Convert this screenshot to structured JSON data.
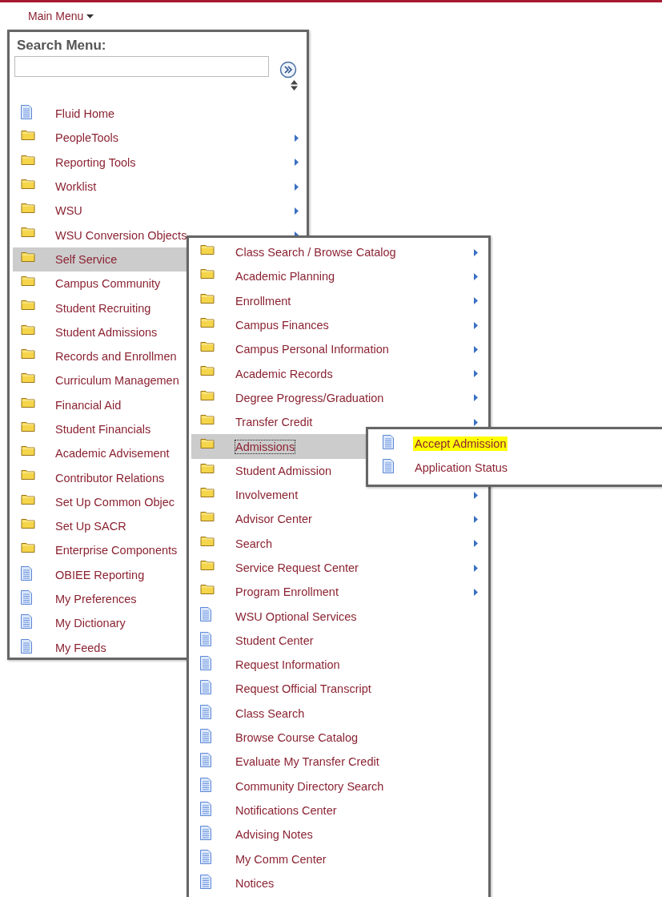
{
  "main_menu": {
    "label": "Main Menu"
  },
  "search_menu": {
    "title": "Search Menu:"
  },
  "menu": [
    {
      "label": "Fluid Home",
      "kind": "page",
      "arrow": false,
      "selected": false
    },
    {
      "label": "PeopleTools",
      "kind": "folder",
      "arrow": true,
      "selected": false
    },
    {
      "label": "Reporting Tools",
      "kind": "folder",
      "arrow": true,
      "selected": false
    },
    {
      "label": "Worklist",
      "kind": "folder",
      "arrow": true,
      "selected": false
    },
    {
      "label": "WSU",
      "kind": "folder",
      "arrow": true,
      "selected": false
    },
    {
      "label": "WSU Conversion Objects",
      "kind": "folder",
      "arrow": true,
      "selected": false
    },
    {
      "label": "Self Service",
      "kind": "folder",
      "arrow": false,
      "selected": true
    },
    {
      "label": "Campus Community",
      "kind": "folder",
      "arrow": false,
      "selected": false
    },
    {
      "label": "Student Recruiting",
      "kind": "folder",
      "arrow": false,
      "selected": false
    },
    {
      "label": "Student Admissions",
      "kind": "folder",
      "arrow": false,
      "selected": false
    },
    {
      "label": "Records and Enrollmen",
      "kind": "folder",
      "arrow": false,
      "selected": false
    },
    {
      "label": "Curriculum Managemen",
      "kind": "folder",
      "arrow": false,
      "selected": false
    },
    {
      "label": "Financial Aid",
      "kind": "folder",
      "arrow": false,
      "selected": false
    },
    {
      "label": "Student Financials",
      "kind": "folder",
      "arrow": false,
      "selected": false
    },
    {
      "label": "Academic Advisement",
      "kind": "folder",
      "arrow": false,
      "selected": false
    },
    {
      "label": "Contributor Relations",
      "kind": "folder",
      "arrow": false,
      "selected": false
    },
    {
      "label": "Set Up Common Objec",
      "kind": "folder",
      "arrow": false,
      "selected": false
    },
    {
      "label": "Set Up SACR",
      "kind": "folder",
      "arrow": false,
      "selected": false
    },
    {
      "label": "Enterprise Components",
      "kind": "folder",
      "arrow": false,
      "selected": false
    },
    {
      "label": "OBIEE Reporting",
      "kind": "page",
      "arrow": false,
      "selected": false
    },
    {
      "label": "My Preferences",
      "kind": "page",
      "arrow": false,
      "selected": false
    },
    {
      "label": "My Dictionary",
      "kind": "page",
      "arrow": false,
      "selected": false
    },
    {
      "label": "My Feeds",
      "kind": "page",
      "arrow": false,
      "selected": false
    }
  ],
  "self_service_menu": [
    {
      "label": "Class Search / Browse Catalog",
      "kind": "folder",
      "arrow": true,
      "selected": false
    },
    {
      "label": "Academic Planning",
      "kind": "folder",
      "arrow": true,
      "selected": false
    },
    {
      "label": "Enrollment",
      "kind": "folder",
      "arrow": true,
      "selected": false
    },
    {
      "label": "Campus Finances",
      "kind": "folder",
      "arrow": true,
      "selected": false
    },
    {
      "label": "Campus Personal Information",
      "kind": "folder",
      "arrow": true,
      "selected": false
    },
    {
      "label": "Academic Records",
      "kind": "folder",
      "arrow": true,
      "selected": false
    },
    {
      "label": "Degree Progress/Graduation",
      "kind": "folder",
      "arrow": true,
      "selected": false
    },
    {
      "label": "Transfer Credit",
      "kind": "folder",
      "arrow": true,
      "selected": false
    },
    {
      "label": "Admissions",
      "kind": "folder",
      "arrow": false,
      "selected": true
    },
    {
      "label": "Student Admission",
      "kind": "folder",
      "arrow": false,
      "selected": false
    },
    {
      "label": "Involvement",
      "kind": "folder",
      "arrow": true,
      "selected": false
    },
    {
      "label": "Advisor Center",
      "kind": "folder",
      "arrow": true,
      "selected": false
    },
    {
      "label": "Search",
      "kind": "folder",
      "arrow": true,
      "selected": false
    },
    {
      "label": "Service Request Center",
      "kind": "folder",
      "arrow": true,
      "selected": false
    },
    {
      "label": "Program Enrollment",
      "kind": "folder",
      "arrow": true,
      "selected": false
    },
    {
      "label": "WSU Optional Services",
      "kind": "page",
      "arrow": false,
      "selected": false
    },
    {
      "label": "Student Center",
      "kind": "page",
      "arrow": false,
      "selected": false
    },
    {
      "label": "Request Information",
      "kind": "page",
      "arrow": false,
      "selected": false
    },
    {
      "label": "Request Official Transcript",
      "kind": "page",
      "arrow": false,
      "selected": false
    },
    {
      "label": "Class Search",
      "kind": "page",
      "arrow": false,
      "selected": false
    },
    {
      "label": "Browse Course Catalog",
      "kind": "page",
      "arrow": false,
      "selected": false
    },
    {
      "label": "Evaluate My Transfer Credit",
      "kind": "page",
      "arrow": false,
      "selected": false
    },
    {
      "label": "Community Directory Search",
      "kind": "page",
      "arrow": false,
      "selected": false
    },
    {
      "label": "Notifications Center",
      "kind": "page",
      "arrow": false,
      "selected": false
    },
    {
      "label": "Advising Notes",
      "kind": "page",
      "arrow": false,
      "selected": false
    },
    {
      "label": "My Comm Center",
      "kind": "page",
      "arrow": false,
      "selected": false
    },
    {
      "label": "Notices",
      "kind": "page",
      "arrow": false,
      "selected": false
    }
  ],
  "admissions_menu": [
    {
      "label": "Accept Admission",
      "kind": "page",
      "highlighted": true
    },
    {
      "label": "Application Status",
      "kind": "page",
      "highlighted": false
    }
  ]
}
